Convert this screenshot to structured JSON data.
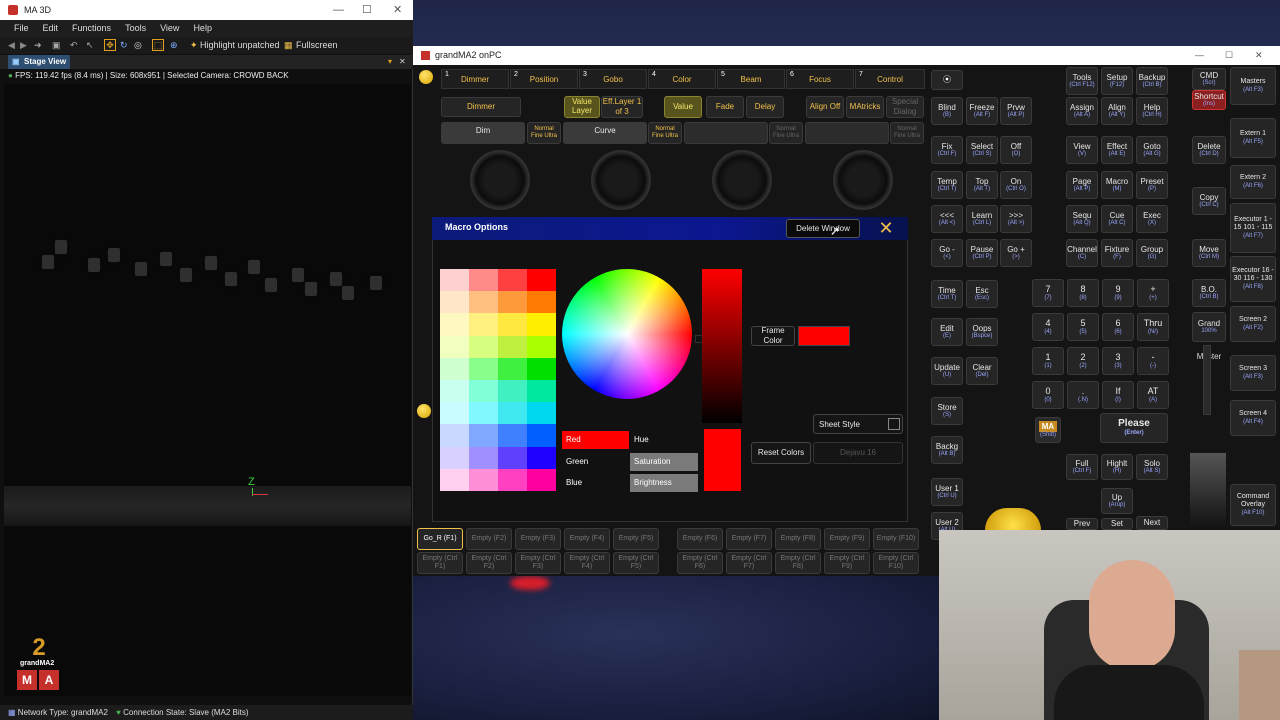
{
  "ma3d": {
    "title": "MA 3D",
    "menu": [
      "File",
      "Edit",
      "Functions",
      "Tools",
      "View",
      "Help"
    ],
    "toolbar": {
      "highlight": "Highlight unpatched",
      "fullscreen": "Fullscreen"
    },
    "stage_tab": "Stage View",
    "stage_info": "FPS: 119.42 fps (8.4 ms) | Size: 608x951 | Selected Camera: CROWD BACK",
    "axis_label": "Z",
    "status_network": "Network Type: grandMA2",
    "status_connection": "Connection State: Slave (MA2 Bits)",
    "logo_number": "2",
    "logo_text": "grandMA2",
    "logo_letters": [
      "M",
      "A"
    ]
  },
  "onpc": {
    "title": "grandMA2 onPC",
    "presets": [
      {
        "num": "1",
        "label": "Dimmer"
      },
      {
        "num": "2",
        "label": "Position"
      },
      {
        "num": "3",
        "label": "Gobo"
      },
      {
        "num": "4",
        "label": "Color"
      },
      {
        "num": "5",
        "label": "Beam"
      },
      {
        "num": "6",
        "label": "Focus"
      },
      {
        "num": "7",
        "label": "Control"
      }
    ],
    "row2": {
      "dimmer": "Dimmer",
      "value_layer": "Value Layer",
      "eff_layer": "Eff.Layer 1 of 3",
      "value": "Value",
      "fade": "Fade",
      "delay": "Delay",
      "align_off": "Align Off",
      "matricks": "MAtricks",
      "special": "Special Dialog"
    },
    "encoders": {
      "dim": "Dim",
      "curve": "Curve",
      "normal": "Normal Fine Ultra"
    },
    "executor_row1": [
      "Go_R (F1)",
      "Empty (F2)",
      "Empty (F3)",
      "Empty (F4)",
      "Empty (F5)",
      "Empty (F6)",
      "Empty (F7)",
      "Empty (F8)",
      "Empty (F9)",
      "Empty (F10)"
    ],
    "executor_row2": [
      "Empty (Ctrl F1)",
      "Empty (Ctrl F2)",
      "Empty (Ctrl F3)",
      "Empty (Ctrl F4)",
      "Empty (Ctrl F5)",
      "Empty (Ctrl F6)",
      "Empty (Ctrl F7)",
      "Empty (Ctrl F8)",
      "Empty (Ctrl F9)",
      "Empty (Ctrl F10)"
    ]
  },
  "dialog": {
    "title": "Macro  Options",
    "delete_window": "Delete Window",
    "frame_color": "Frame Color",
    "sheet_style": "Sheet Style",
    "reset_colors": "Reset Colors",
    "font": "Dejavu 16",
    "channels": {
      "red": "Red",
      "green": "Green",
      "blue": "Blue",
      "hue": "Hue",
      "saturation": "Saturation",
      "brightness": "Brightness"
    },
    "accent_color": "#ff0000"
  },
  "keypad": {
    "col1": [
      {
        "l": "Blind",
        "k": "(B)"
      },
      {
        "l": "Fix",
        "k": "(Ctrl F)"
      },
      {
        "l": "Temp",
        "k": "(Ctrl T)"
      },
      {
        "l": "<<<",
        "k": "(Alt <)"
      },
      {
        "l": "Go -",
        "k": "(<)"
      },
      {
        "l": "Time",
        "k": "(Ctrl T)"
      },
      {
        "l": "Edit",
        "k": "(E)"
      },
      {
        "l": "Update",
        "k": "(U)"
      },
      {
        "l": "Store",
        "k": "(S)"
      },
      {
        "l": "Backg",
        "k": "(Alt B)"
      },
      {
        "l": "User 1",
        "k": "(Ctrl U)"
      },
      {
        "l": "User 2",
        "k": "(Alt U)"
      }
    ],
    "col2": [
      {
        "l": "Freeze",
        "k": "(Alt F)"
      },
      {
        "l": "Select",
        "k": "(Ctrl S)"
      },
      {
        "l": "Top",
        "k": "(Alt T)"
      },
      {
        "l": "Learn",
        "k": "(Ctrl L)"
      },
      {
        "l": "Pause",
        "k": "(Ctrl P)"
      },
      {
        "l": "Esc",
        "k": "(Esc)"
      },
      {
        "l": "Oops",
        "k": "(Bspce)"
      },
      {
        "l": "Clear",
        "k": "(Del)"
      }
    ],
    "col3": [
      {
        "l": "Prvw",
        "k": "(Alt P)"
      },
      {
        "l": "Off",
        "k": "(O)"
      },
      {
        "l": "On",
        "k": "(Ctrl O)"
      },
      {
        "l": ">>>",
        "k": "(Alt >)"
      },
      {
        "l": "Go +",
        "k": "(>)"
      }
    ],
    "top_right": [
      {
        "l": "Tools",
        "k": "(Ctrl F12)"
      },
      {
        "l": "Setup",
        "k": "(F12)"
      },
      {
        "l": "Backup",
        "k": "(Ctrl B)"
      },
      {
        "l": "Assign",
        "k": "(Alt A)"
      },
      {
        "l": "Align",
        "k": "(Alt Y)"
      },
      {
        "l": "Help",
        "k": "(Ctrl H)"
      },
      {
        "l": "View",
        "k": "(V)"
      },
      {
        "l": "Effect",
        "k": "(Alt E)"
      },
      {
        "l": "Goto",
        "k": "(Alt G)"
      },
      {
        "l": "Page",
        "k": "(Alt P)"
      },
      {
        "l": "Macro",
        "k": "(M)"
      },
      {
        "l": "Preset",
        "k": "(P)"
      },
      {
        "l": "Sequ",
        "k": "(Alt Q)"
      },
      {
        "l": "Cue",
        "k": "(Alt C)"
      },
      {
        "l": "Exec",
        "k": "(X)"
      },
      {
        "l": "Channel",
        "k": "(C)"
      },
      {
        "l": "Fixture",
        "k": "(F)"
      },
      {
        "l": "Group",
        "k": "(G)"
      }
    ],
    "numpad": [
      {
        "l": "7",
        "k": "(7)"
      },
      {
        "l": "8",
        "k": "(8)"
      },
      {
        "l": "9",
        "k": "(9)"
      },
      {
        "l": "+",
        "k": "(+)"
      },
      {
        "l": "4",
        "k": "(4)"
      },
      {
        "l": "5",
        "k": "(5)"
      },
      {
        "l": "6",
        "k": "(6)"
      },
      {
        "l": "Thru",
        "k": "(N/)"
      },
      {
        "l": "1",
        "k": "(1)"
      },
      {
        "l": "2",
        "k": "(2)"
      },
      {
        "l": "3",
        "k": "(3)"
      },
      {
        "l": "-",
        "k": "(-)"
      },
      {
        "l": "0",
        "k": "(0)"
      },
      {
        "l": ".",
        "k": "(.N)"
      },
      {
        "l": "If",
        "k": "(I)"
      },
      {
        "l": "AT",
        "k": "(A)"
      }
    ],
    "ma": "MA",
    "shift": "(Shift)",
    "please": "Please",
    "enter": "(Enter)",
    "full": "Full",
    "full_k": "(Ctrl F)",
    "highlt": "Highlt",
    "highlt_k": "(H)",
    "solo": "Solo",
    "solo_k": "(Alt S)",
    "up": "Up",
    "up_k": "(Arup)",
    "prev": "Prev",
    "set": "Set",
    "next": "Next"
  },
  "side": {
    "cmd": "CMD",
    "cmd_k": "(Scr)",
    "shortcut": "Shortcut",
    "shortcut_k": "(Ins)",
    "delete": "Delete",
    "delete_k": "(Ctrl D)",
    "copy": "Copy",
    "copy_k": "(Ctrl C)",
    "move": "Move",
    "move_k": "(Ctrl M)",
    "bo": "B.O.",
    "bo_k": "(Ctrl B)",
    "grand": "Grand",
    "grand_val": "100%",
    "master": "Master",
    "screens": [
      {
        "l": "Masters",
        "k": "(Alt F3)"
      },
      {
        "l": "Extern 1",
        "k": "(Alt F5)"
      },
      {
        "l": "Extern 2",
        "k": "(Alt F6)"
      },
      {
        "l": "Executor 1 - 15 101 - 115",
        "k": "(Alt F7)"
      },
      {
        "l": "Executor 16 - 30 116 - 130",
        "k": "(Alt F8)"
      },
      {
        "l": "Screen 2",
        "k": "(Alt F2)"
      },
      {
        "l": "Screen 3",
        "k": "(Alt F3)"
      },
      {
        "l": "Screen 4",
        "k": "(Alt F4)"
      },
      {
        "l": "Command Overlay",
        "k": "(Alt F10)"
      }
    ]
  }
}
